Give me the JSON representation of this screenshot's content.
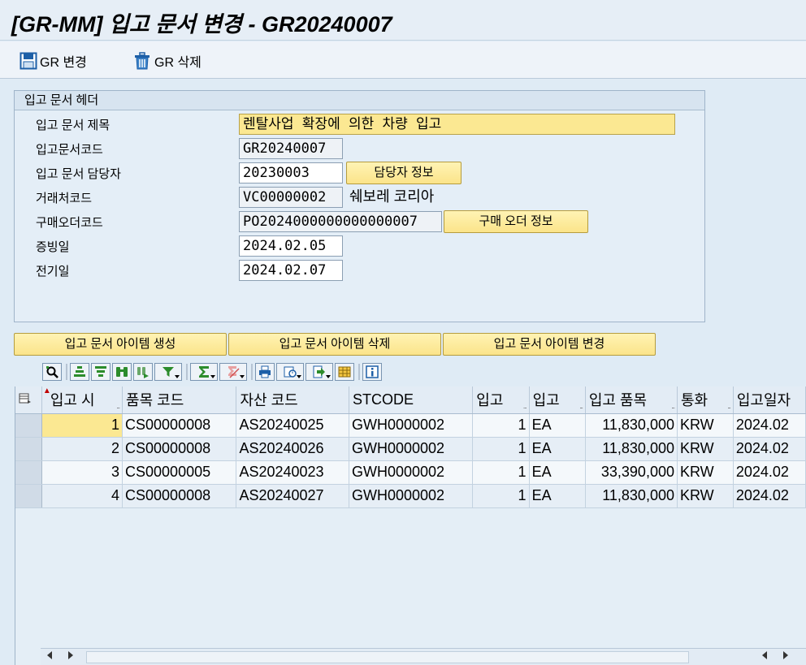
{
  "window": {
    "title": "[GR-MM] 입고 문서 변경 - GR20240007"
  },
  "toolbar": {
    "change_label": "GR 변경",
    "delete_label": "GR 삭제"
  },
  "header_panel": {
    "title": "입고 문서 헤더",
    "fields": {
      "title_label": "입고 문서 제목",
      "title_value": "렌탈사업 확장에 의한 차량 입고",
      "code_label": "입고문서코드",
      "code_value": "GR20240007",
      "manager_label": "입고 문서 담당자",
      "manager_value": "20230003",
      "manager_button": "담당자 정보",
      "vendor_label": "거래처코드",
      "vendor_value": "VC00000002",
      "vendor_name": "쉐보레 코리아",
      "po_label": "구매오더코드",
      "po_value": "PO2024000000000000007",
      "po_button": "구매 오더 정보",
      "doc_date_label": "증빙일",
      "doc_date_value": "2024.02.05",
      "post_date_label": "전기일",
      "post_date_value": "2024.02.07"
    }
  },
  "actions": {
    "create_item": "입고 문서 아이템 생성",
    "delete_item": "입고 문서 아이템 삭제",
    "change_item": "입고 문서 아이템 변경"
  },
  "grid": {
    "columns": [
      "입고 시",
      "품목 코드",
      "자산 코드",
      "STCODE",
      "입고",
      "입고",
      "입고 품목",
      "통화",
      "입고일자"
    ],
    "rows": [
      [
        "1",
        "CS00000008",
        "AS20240025",
        "GWH0000002",
        "1",
        "EA",
        "11,830,000",
        "KRW",
        "2024.02"
      ],
      [
        "2",
        "CS00000008",
        "AS20240026",
        "GWH0000002",
        "1",
        "EA",
        "11,830,000",
        "KRW",
        "2024.02"
      ],
      [
        "3",
        "CS00000005",
        "AS20240023",
        "GWH0000002",
        "1",
        "EA",
        "33,390,000",
        "KRW",
        "2024.02"
      ],
      [
        "4",
        "CS00000008",
        "AS20240027",
        "GWH0000002",
        "1",
        "EA",
        "11,830,000",
        "KRW",
        "2024.02"
      ]
    ]
  },
  "grid_toolbar_icons": [
    "details-icon",
    "sort-ascending-icon",
    "sort-descending-icon",
    "find-icon",
    "find-next-icon",
    "filter-icon",
    "sum-icon",
    "subtotal-icon",
    "print-icon",
    "views-icon",
    "export-icon",
    "layout-icon",
    "info-icon"
  ],
  "colors": {
    "accent_yellow": "#fbe892",
    "background": "#dfebf5"
  }
}
